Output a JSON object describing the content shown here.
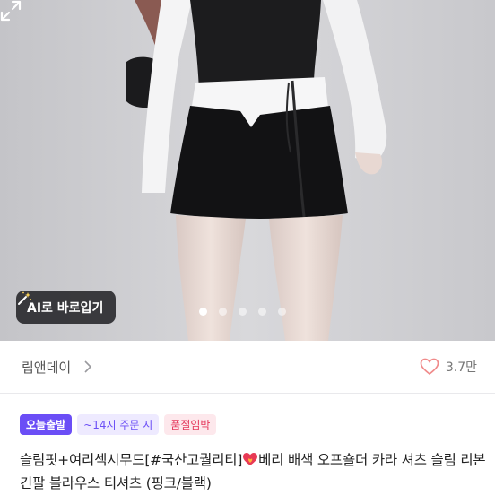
{
  "hero": {
    "ai_button_label": "AI로 바로입기",
    "slide_count": 5,
    "active_slide": 1
  },
  "seller": {
    "name": "립앤데이",
    "like_count": "3.7만"
  },
  "badges": {
    "today_ship": "오늘출발",
    "order_cutoff": "~14시 주문 시",
    "low_stock": "품절임박"
  },
  "product": {
    "title_part1": "슬림핏+여리섹시무드[#국산고퀄리티]",
    "title_part2": "베리 배색 오프숄더 카라 셔츠 슬림 리본 긴팔 블라우스 티셔츠 (핑크/블랙)"
  },
  "colors": {
    "accent": "#6b4ef6",
    "badge_red": "#e5395c",
    "heart_outline": "#f08a8a"
  },
  "icons": [
    "magic-wand-icon",
    "expand-icon",
    "chevron-right-icon",
    "heart-outline-icon",
    "burning-heart-icon"
  ]
}
